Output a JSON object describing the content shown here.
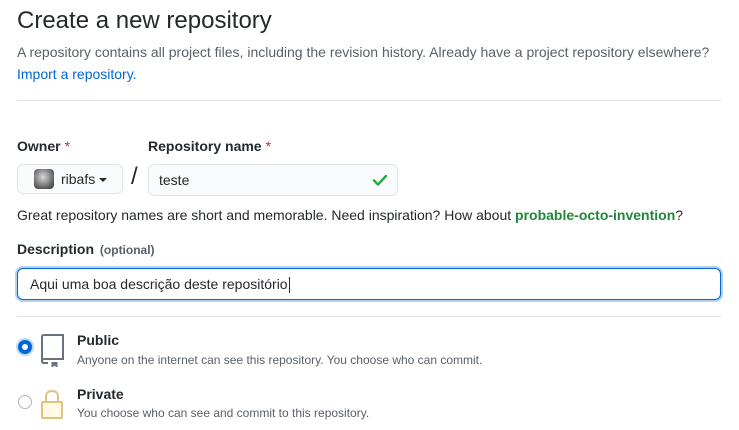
{
  "header": {
    "title": "Create a new repository",
    "subtitle": "A repository contains all project files, including the revision history. Already have a project repository elsewhere?",
    "import_link": "Import a repository."
  },
  "owner": {
    "label": "Owner",
    "required_mark": "*",
    "selected": "ribafs",
    "avatar_icon": "user-avatar"
  },
  "repository": {
    "label": "Repository name",
    "required_mark": "*",
    "value": "teste",
    "separator": "/",
    "valid_icon": "check-icon",
    "valid_color": "#28a745"
  },
  "hint": {
    "text": "Great repository names are short and memorable. Need inspiration? How about ",
    "suggestion": "probable-octo-invention",
    "suffix": "?"
  },
  "description": {
    "label": "Description",
    "optional": "(optional)",
    "value": "Aqui uma boa descrição deste repositório"
  },
  "visibility": {
    "options": [
      {
        "title": "Public",
        "description": "Anyone on the internet can see this repository. You choose who can commit.",
        "selected": true,
        "icon": "repo-icon"
      },
      {
        "title": "Private",
        "description": "You choose who can see and commit to this repository.",
        "selected": false,
        "icon": "lock-icon"
      }
    ]
  },
  "colors": {
    "link": "#0366d6",
    "suggestion": "#22863a",
    "required": "#cb2431",
    "focus": "#0366d6"
  }
}
